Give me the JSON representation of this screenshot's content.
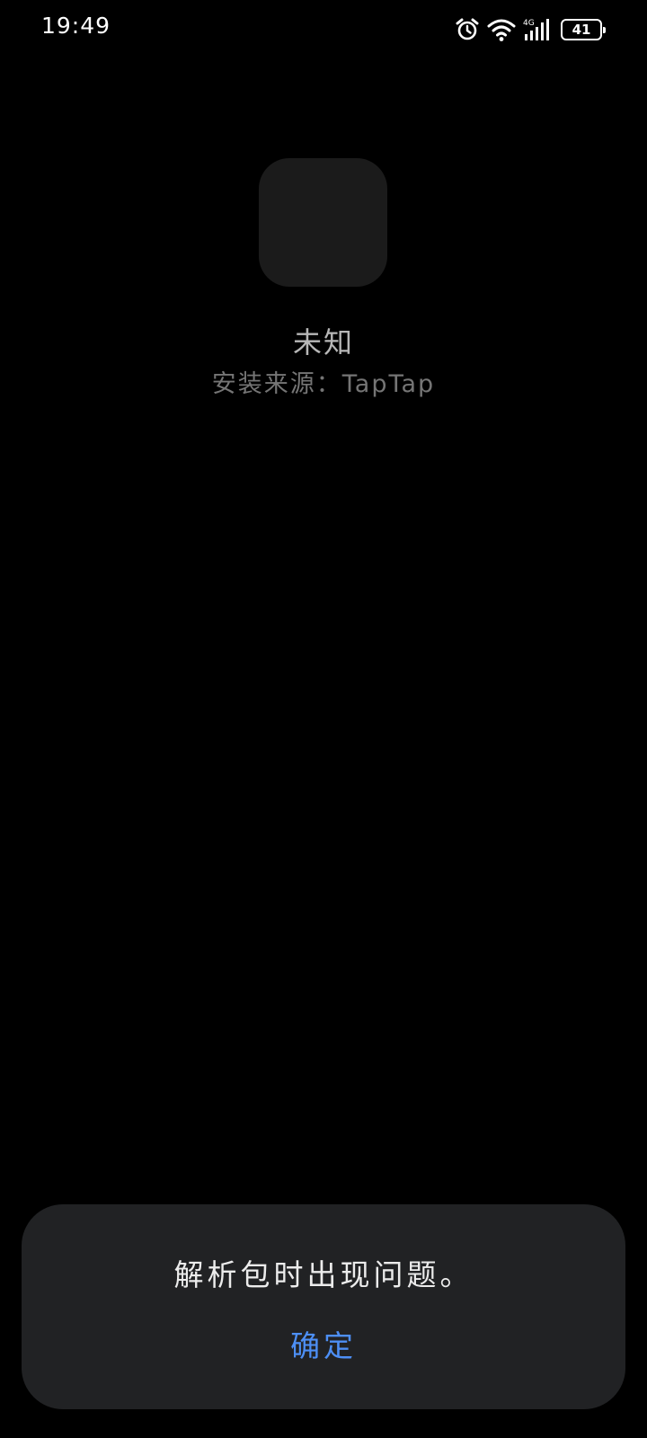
{
  "status_bar": {
    "time": "19:49",
    "battery_level": "41",
    "network_label": "4G",
    "icons": [
      "alarm-icon",
      "wifi-icon",
      "signal-icon",
      "battery-icon"
    ]
  },
  "app": {
    "name": "未知",
    "install_source": "安装来源：TapTap"
  },
  "dialog": {
    "message": "解析包时出现问题。",
    "confirm_label": "确定"
  },
  "colors": {
    "background": "#000000",
    "icon_placeholder": "#1b1b1b",
    "dialog_background": "#212224",
    "accent": "#4d8ff5"
  }
}
